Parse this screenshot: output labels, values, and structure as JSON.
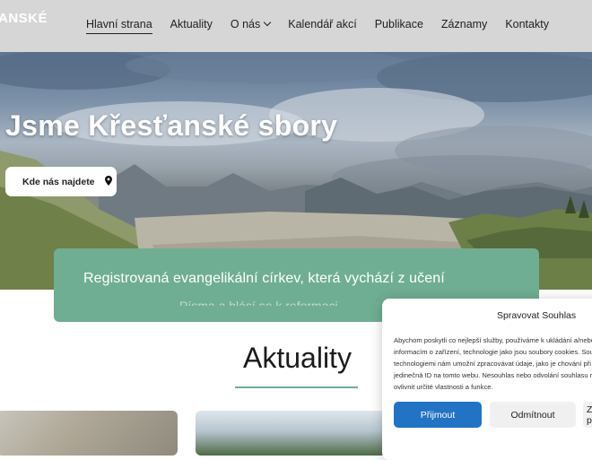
{
  "header": {
    "logo_text": "ANSKÉ",
    "nav": [
      {
        "label": "Hlavní strana"
      },
      {
        "label": "Aktuality"
      },
      {
        "label": "O nás"
      },
      {
        "label": "Kalendář akcí"
      },
      {
        "label": "Publikace"
      },
      {
        "label": "Záznamy"
      },
      {
        "label": "Kontakty"
      }
    ]
  },
  "hero": {
    "title": "Jsme Křesťanské sbory",
    "button_label": "Kde nás najdete"
  },
  "mission": {
    "text": "Registrovaná evangelikální církev, která vychází z učení",
    "text_line2": "Písma a hlásí se k reformaci"
  },
  "news": {
    "title": "Aktuality"
  },
  "cookie": {
    "title": "Spravovat Souhlas",
    "text_lines": [
      "Abychom poskytli co nejlepší služby, používáme k ukládání a/nebo přístupu k",
      "informacím o zařízení, technologie jako jsou soubory cookies. Souhlas s těmito",
      "technologiemi nám umožní zpracovávat údaje, jako je chování při procházení nebo",
      "jedinečná ID na tomto webu. Nesouhlas nebo odvolání souhlasu může nepříznivě",
      "ovlivnit určité vlastnosti a funkce."
    ],
    "accept_label": "Přijmout",
    "reject_label": "Odmítnout",
    "more_label": "Zobrazit předvolby"
  },
  "colors": {
    "accent_green": "#6fae92",
    "accept_blue": "#2273c4",
    "header_bg": "#d6d6d6"
  },
  "icons": {
    "hero_button_icon": "map-pin-icon",
    "dropdown_icon": "chevron-down-icon"
  }
}
